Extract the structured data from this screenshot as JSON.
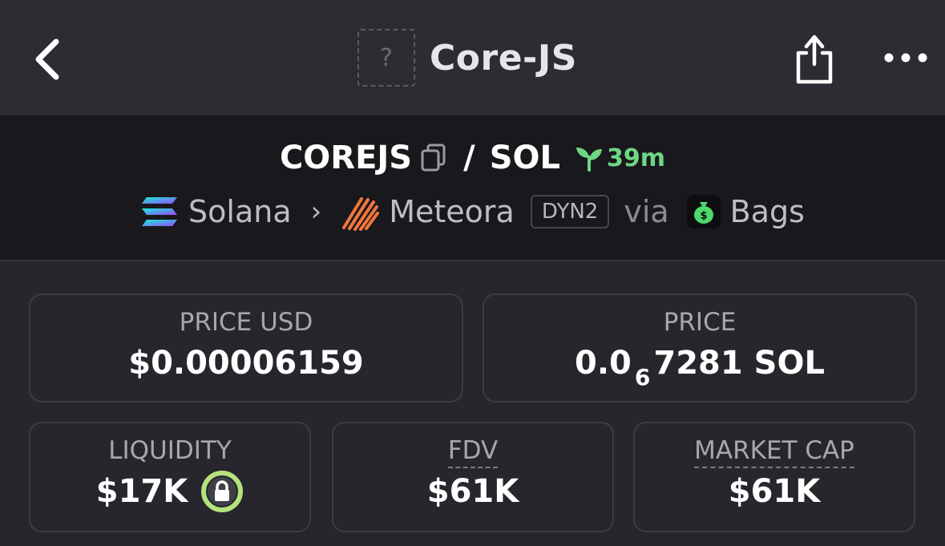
{
  "nav": {
    "title": "Core-JS",
    "placeholder_glyph": "?",
    "icons": [
      "chevron-left-icon",
      "share-icon",
      "more-icon"
    ]
  },
  "pair": {
    "base": "COREJS",
    "separator": "/",
    "quote": "SOL",
    "age": "39m"
  },
  "chain": {
    "network": "Solana",
    "dex": "Meteora",
    "pool_type": "DYN2",
    "via": "via",
    "launchpad": "Bags"
  },
  "stats": {
    "price_usd": {
      "label": "PRICE USD",
      "value": "$0.00006159"
    },
    "price": {
      "label": "PRICE",
      "prefix": "0.0",
      "zeros": "6",
      "digits": "7281",
      "unit": "SOL"
    },
    "liquidity": {
      "label": "LIQUIDITY",
      "value": "$17K"
    },
    "fdv": {
      "label": "FDV",
      "value": "$61K"
    },
    "market_cap": {
      "label": "MARKET CAP",
      "value": "$61K"
    }
  },
  "colors": {
    "accent_green": "#6ed683",
    "lock_ring": "#b5e27c",
    "background": "#26262c"
  }
}
